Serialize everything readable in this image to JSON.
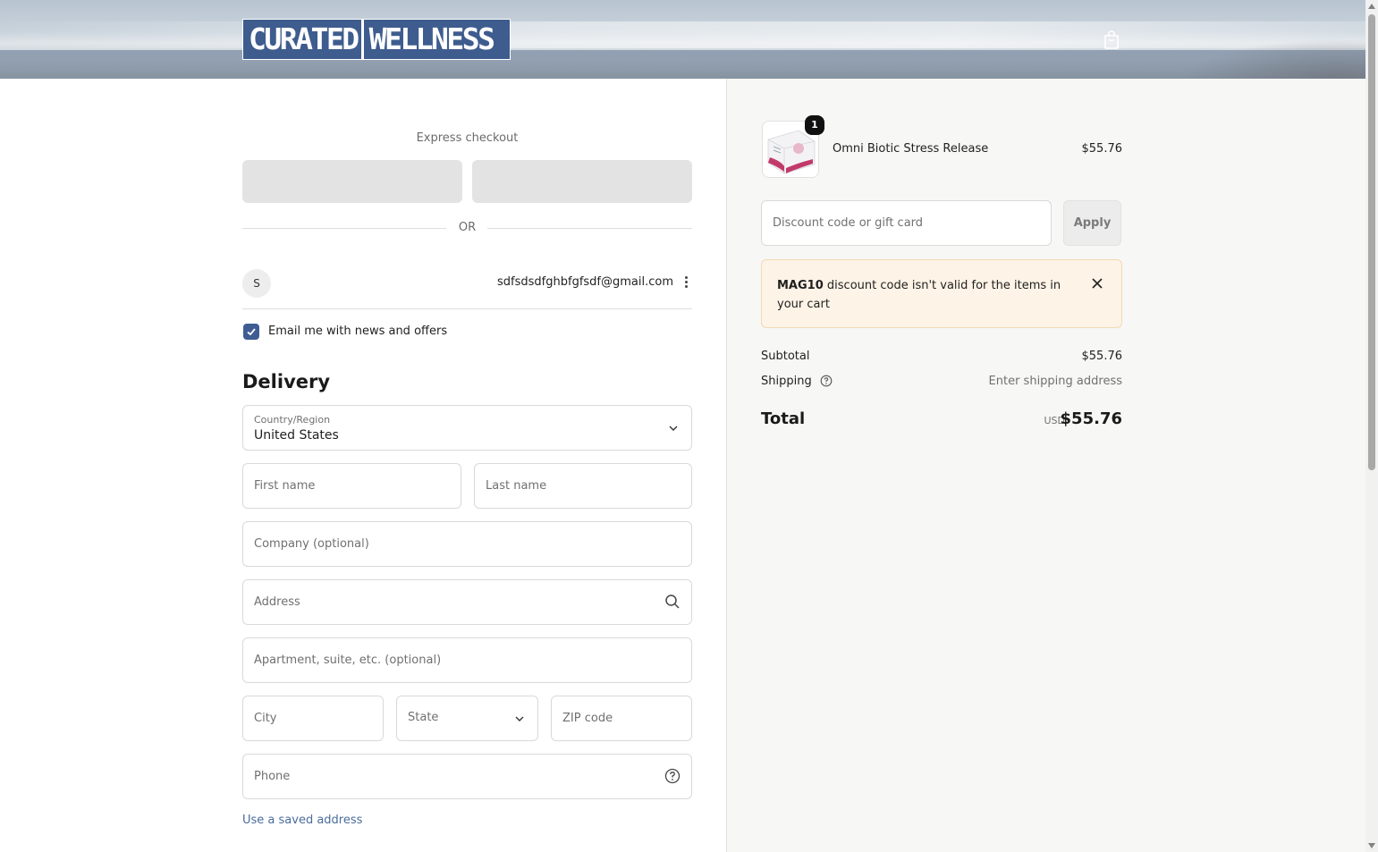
{
  "header": {
    "logo_part1": "CURATED",
    "logo_part2": "WELLNESS",
    "cart_icon": "shopping-bag-icon"
  },
  "express": {
    "title": "Express checkout",
    "divider": "OR"
  },
  "account": {
    "avatar_initial": "S",
    "email": "sdfsdsdfghbfgfsdf@gmail.com",
    "menu_icon": "kebab-menu-icon"
  },
  "newsletter": {
    "label": "Email me with news and offers",
    "checked": true
  },
  "delivery": {
    "title": "Delivery",
    "country_label": "Country/Region",
    "country_value": "United States",
    "first_name_placeholder": "First name",
    "last_name_placeholder": "Last name",
    "company_placeholder": "Company (optional)",
    "address_placeholder": "Address",
    "apartment_placeholder": "Apartment, suite, etc. (optional)",
    "city_placeholder": "City",
    "state_placeholder": "State",
    "zip_placeholder": "ZIP code",
    "phone_placeholder": "Phone",
    "saved_address_link": "Use a saved address"
  },
  "summary": {
    "product": {
      "name": "Omni Biotic Stress Release",
      "price": "$55.76",
      "quantity": "1"
    },
    "discount_placeholder": "Discount code or gift card",
    "apply_label": "Apply",
    "alert": {
      "code": "MAG10",
      "message": "discount code isn't valid for the items in your cart"
    },
    "subtotal_label": "Subtotal",
    "subtotal_value": "$55.76",
    "shipping_label": "Shipping",
    "shipping_value": "Enter shipping address",
    "total_label": "Total",
    "currency": "USD",
    "total_value": "$55.76"
  },
  "colors": {
    "accent": "#3f5d93",
    "link": "#4a6d9c",
    "alert_bg": "#fdf3e6",
    "summary_bg": "#f7f7f5"
  }
}
